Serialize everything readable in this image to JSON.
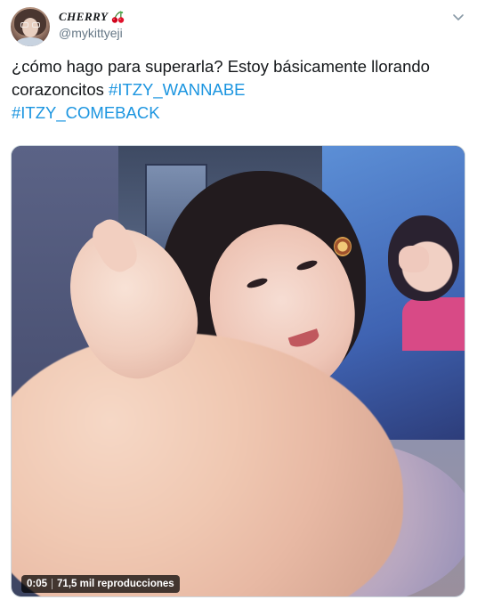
{
  "user": {
    "display_name": "CHERRY",
    "username": "@mykittyeji",
    "name_emoji_icon": "cherry-icon"
  },
  "tweet": {
    "text_plain": "¿cómo hago para superarla? Estoy básicamente llorando corazoncitos ",
    "hashtags": [
      "#ITZY_WANNABE",
      "#ITZY_COMEBACK"
    ]
  },
  "media": {
    "type": "video",
    "timestamp": "0:05",
    "views": "71,5 mil reproducciones"
  },
  "colors": {
    "hashtag": "#1b95e0",
    "text": "#14171a",
    "secondary": "#657786"
  },
  "icons": {
    "menu": "chevron-down-icon",
    "name": "cherry-icon"
  }
}
